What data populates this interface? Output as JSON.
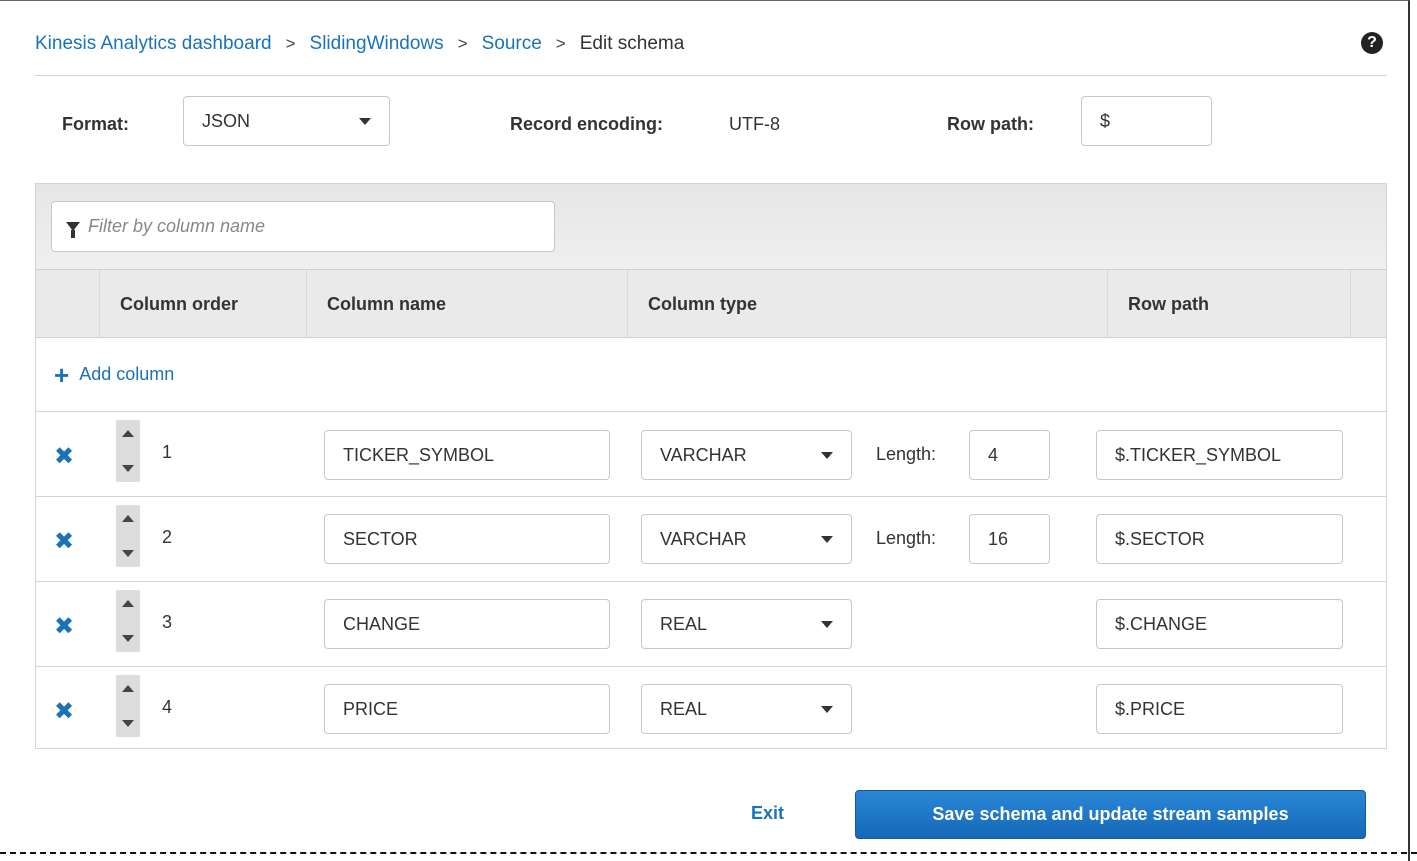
{
  "breadcrumb": {
    "items": [
      "Kinesis Analytics dashboard",
      "SlidingWindows",
      "Source"
    ],
    "separator": ">",
    "current": "Edit schema"
  },
  "help_icon": "question-circle-icon",
  "format": {
    "label": "Format:",
    "value": "JSON",
    "record_encoding_label": "Record encoding:",
    "record_encoding_value": "UTF-8",
    "row_path_label": "Row path:",
    "row_path_value": "$"
  },
  "filter": {
    "placeholder": "Filter by column name",
    "icon": "filter-icon"
  },
  "table": {
    "headers": [
      "Column order",
      "Column name",
      "Column type",
      "Row path"
    ],
    "add_column_label": "Add column",
    "length_label": "Length:",
    "rows": [
      {
        "order": "1",
        "name": "TICKER_SYMBOL",
        "type": "VARCHAR",
        "length": "4",
        "row_path": "$.TICKER_SYMBOL"
      },
      {
        "order": "2",
        "name": "SECTOR",
        "type": "VARCHAR",
        "length": "16",
        "row_path": "$.SECTOR"
      },
      {
        "order": "3",
        "name": "CHANGE",
        "type": "REAL",
        "length": null,
        "row_path": "$.CHANGE"
      },
      {
        "order": "4",
        "name": "PRICE",
        "type": "REAL",
        "length": null,
        "row_path": "$.PRICE"
      }
    ]
  },
  "footer": {
    "exit_label": "Exit",
    "save_label": "Save schema and update stream samples"
  },
  "colors": {
    "link": "#1a73b8",
    "primary_button": "#1f77c8",
    "header_bg": "#eaeaea"
  }
}
